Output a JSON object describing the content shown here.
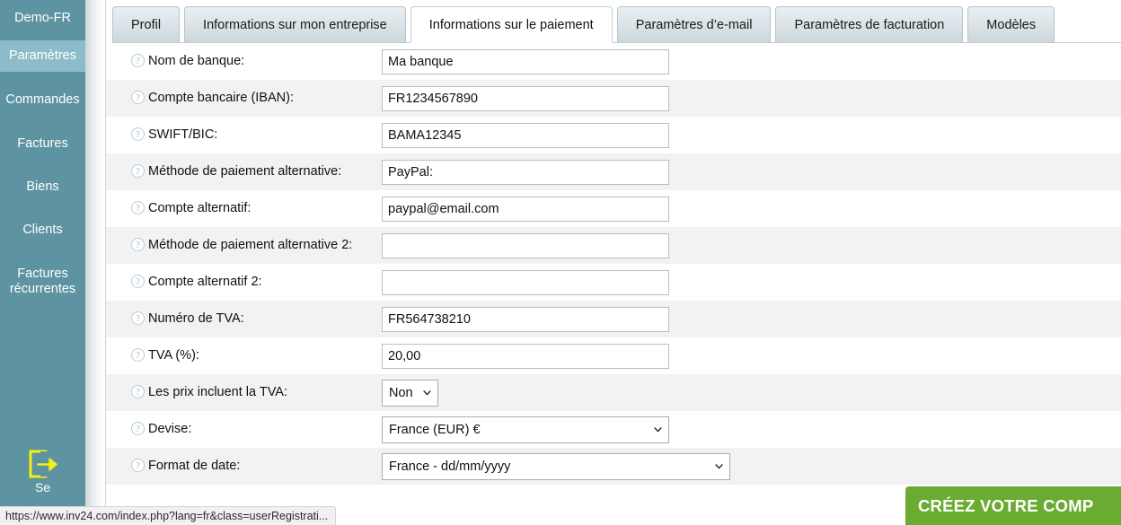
{
  "sidebar": {
    "brand": "Demo-FR",
    "items": [
      {
        "label": "Paramètres",
        "active": true
      },
      {
        "label": "Commandes",
        "active": false
      },
      {
        "label": "Factures",
        "active": false
      },
      {
        "label": "Biens",
        "active": false
      },
      {
        "label": "Clients",
        "active": false
      },
      {
        "label": "Factures récurrentes",
        "active": false
      }
    ],
    "logout": {
      "label": "Se",
      "icon": "logout-icon",
      "icon_color": "#f2ee18"
    }
  },
  "tabs": [
    {
      "label": "Profil",
      "active": false
    },
    {
      "label": "Informations sur mon entreprise",
      "active": false
    },
    {
      "label": "Informations sur le paiement",
      "active": true
    },
    {
      "label": "Paramètres d’e-mail",
      "active": false
    },
    {
      "label": "Paramètres de facturation",
      "active": false
    },
    {
      "label": "Modèles",
      "active": false
    }
  ],
  "form": {
    "help_icon": "?",
    "rows": [
      {
        "label": "Nom de banque:",
        "type": "text",
        "value": "Ma banque"
      },
      {
        "label": "Compte bancaire (IBAN):",
        "type": "text",
        "value": "FR1234567890"
      },
      {
        "label": "SWIFT/BIC:",
        "type": "text",
        "value": "BAMA12345"
      },
      {
        "label": "Méthode de paiement alternative:",
        "type": "text",
        "value": "PayPal:"
      },
      {
        "label": "Compte alternatif:",
        "type": "text",
        "value": "paypal@email.com"
      },
      {
        "label": "Méthode de paiement alternative 2:",
        "type": "text",
        "value": ""
      },
      {
        "label": "Compte alternatif 2:",
        "type": "text",
        "value": ""
      },
      {
        "label": "Numéro de TVA:",
        "type": "text",
        "value": "FR564738210"
      },
      {
        "label": "TVA (%):",
        "type": "text",
        "value": "20,00"
      },
      {
        "label": "Les prix incluent la TVA:",
        "type": "select",
        "value": "Non",
        "size": "small"
      },
      {
        "label": "Devise:",
        "type": "select",
        "value": "France (EUR) €",
        "size": "medium"
      },
      {
        "label": "Format de date:",
        "type": "select",
        "value": "France - dd/mm/yyyy",
        "size": "large"
      }
    ]
  },
  "statusbar": {
    "url": "https://www.inv24.com/index.php?lang=fr&class=userRegistrati..."
  },
  "cta": {
    "label": "CRÉEZ VOTRE COMP",
    "color": "#6aab32"
  },
  "colors": {
    "sidebar_bg": "#5e94a1",
    "sidebar_active_bg": "#8cbcc9",
    "row_alt_bg": "#f2f2f2",
    "accent_green": "#6aab32"
  }
}
